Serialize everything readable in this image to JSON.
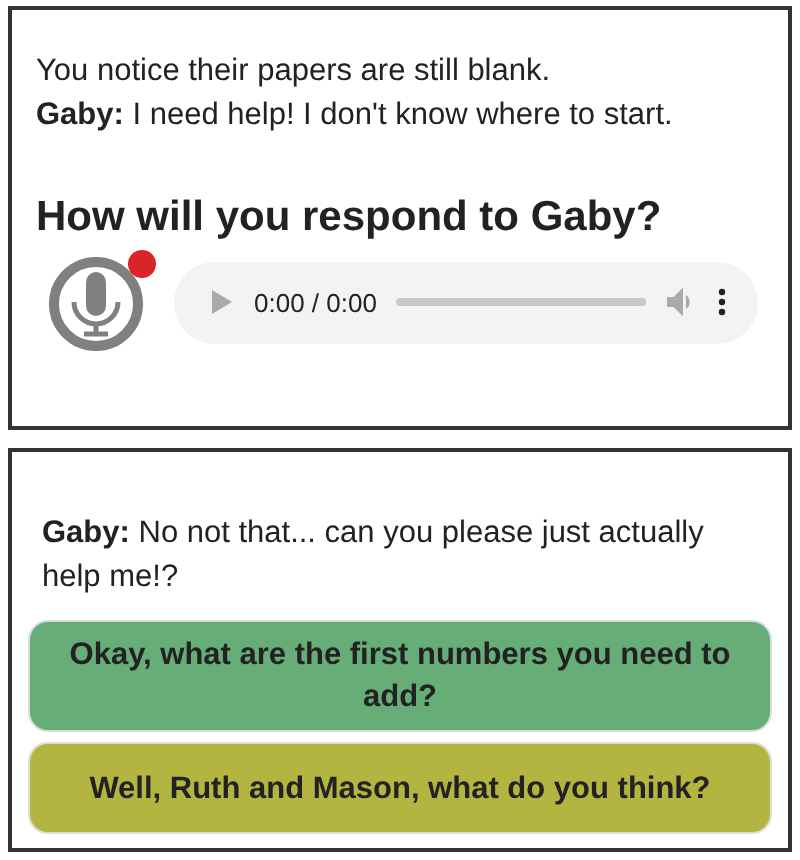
{
  "prompt_panel": {
    "lines": [
      "You notice their papers are still blank.",
      "**Gaby:** I need help! I don't know where to start."
    ],
    "question": "How will you respond to Gaby?",
    "recorder": {
      "recording": true
    },
    "audio_player": {
      "time": "0:00 / 0:00"
    }
  },
  "reply_panel": {
    "line": "**Gaby:** No not that... can you please just actually help me!?",
    "choices": [
      {
        "label": "Okay, what are the first numbers you need to add?",
        "color": "#66ad77"
      },
      {
        "label": "Well, Ruth and Mason, what do you think?",
        "color": "#b2b540"
      }
    ]
  }
}
